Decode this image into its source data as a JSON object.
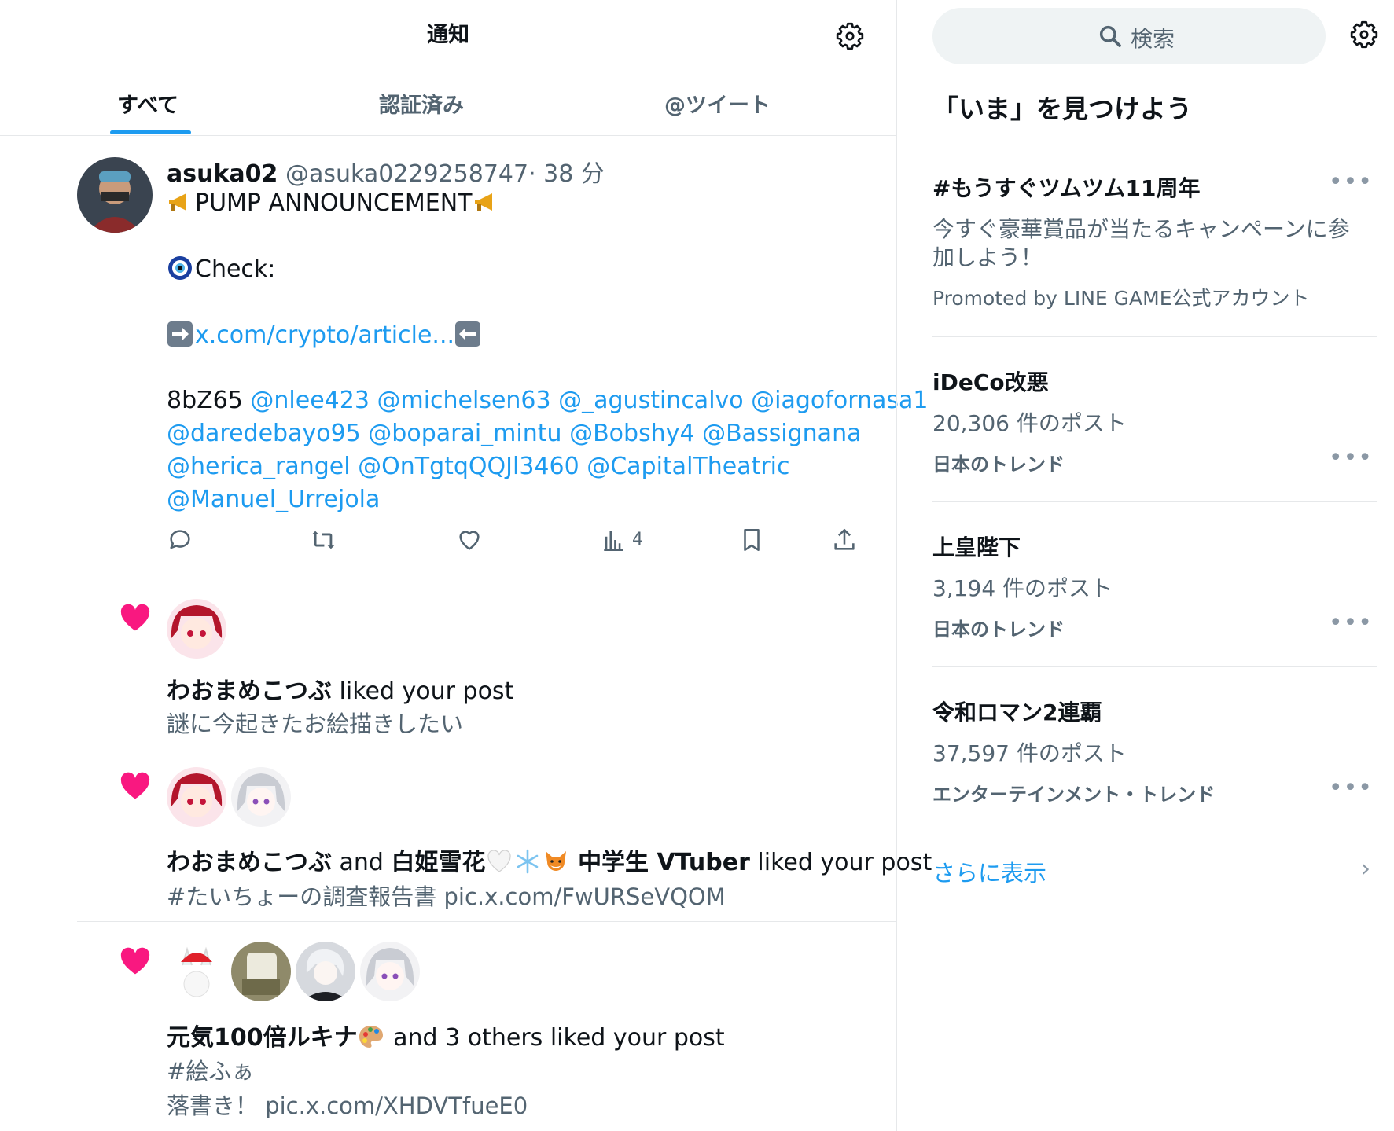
{
  "header": {
    "title": "通知"
  },
  "tabs": [
    "すべて",
    "認証済み",
    "@ツイート"
  ],
  "tweet": {
    "name": "asuka02",
    "handle": "@asuka0229258747",
    "time": "· 38 分",
    "line1": "PUMP ANNOUNCEMENT",
    "line2": "Check:",
    "link": "x.com/crypto/article...",
    "code": "8bZ65",
    "mentions_line1": "@nlee423 @michelsen63 @_agustincalvo @iagofornasa1",
    "mentions_line2": "@daredebayo95 @boparai_mintu @Bobshy4 @Bassignana",
    "mentions_line3": "@herica_rangel @OnTgtqQQJl3460 @CapitalTheatric",
    "mentions_line4": "@Manuel_Urrejola",
    "views": "4"
  },
  "notifications": [
    {
      "name": "わおまめこつぶ",
      "action": " liked your post",
      "sub": "謎に今起きたお絵描きしたい"
    },
    {
      "name": "わおまめこつぶ",
      "and": " and ",
      "name2": "白姫雪花",
      "name3": "中学生 VTuber",
      "action": " liked your post",
      "sub": "#たいちょーの調査報告書 pic.x.com/FwURSeVQOM"
    },
    {
      "name": "元気100倍ルキナ",
      "action": " and 3 others liked your post",
      "sub": "#絵ふぁ",
      "sub2": "落書き！ pic.x.com/XHDVTfueE0"
    }
  ],
  "sidebar": {
    "search_placeholder": "検索",
    "heading": "「いま」を見つけよう",
    "trends": [
      {
        "title": "#もうすぐツムツム11周年",
        "desc1": "今すぐ豪華賞品が当たるキャンペーンに参",
        "desc2": "加しよう！",
        "promo": "Promoted by LINE GAME公式アカウント"
      },
      {
        "title": "iDeCo改悪",
        "count": "20,306 件のポスト",
        "category": "日本のトレンド"
      },
      {
        "title": "上皇陛下",
        "count": "3,194 件のポスト",
        "category": "日本のトレンド"
      },
      {
        "title": "令和ロマン2連覇",
        "count": "37,597 件のポスト",
        "category": "エンターテインメント・トレンド"
      }
    ],
    "show_more": "さらに表示",
    "dots": "•••",
    "chevron": "›"
  },
  "colors": {
    "accent": "#1d9bf0",
    "like": "#f91880",
    "muted": "#536471"
  },
  "icons": [
    "gear-icon",
    "search-icon",
    "reply-icon",
    "retweet-icon",
    "like-icon",
    "views-icon",
    "bookmark-icon",
    "share-icon",
    "heart-icon"
  ]
}
